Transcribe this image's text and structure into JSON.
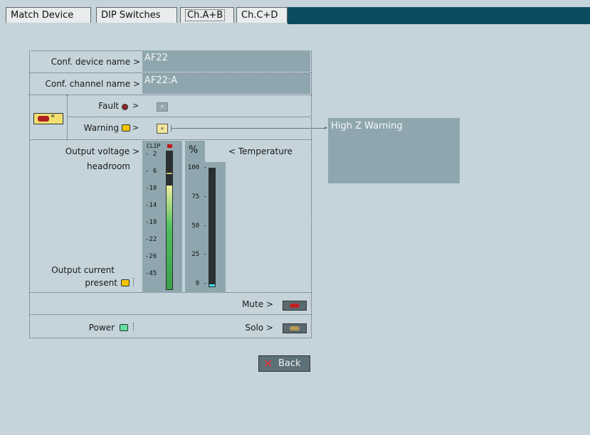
{
  "tabs": [
    {
      "label": "Match Device"
    },
    {
      "label": "DIP Switches"
    },
    {
      "label": "Ch.A+B",
      "active": true
    },
    {
      "label": "Ch.C+D"
    }
  ],
  "panel": {
    "device_name_label": "Conf. device name >",
    "device_name_value": "AF22",
    "channel_name_label": "Conf. channel name >",
    "channel_name_value": "AF22:A",
    "fault_label": "Fault",
    "warning_label": "Warning",
    "warning_message": "High Z Warning",
    "output_voltage_label_line1": "Output voltage >",
    "output_voltage_label_line2": "headroom",
    "percent_label": "%",
    "temperature_label": "< Temperature",
    "output_current_line1": "Output current",
    "output_current_line2": "present",
    "mute_label": "Mute >",
    "power_label": "Power",
    "solo_label": "Solo >",
    "arrow": ">",
    "clip_label": "CLIP",
    "voltage_scale": [
      "- 2",
      "- 6",
      "-10",
      "-14",
      "-18",
      "-22",
      "-26",
      "-45"
    ],
    "temp_scale": [
      "100 -",
      "75 -",
      "50 -",
      "25 -",
      "0 -"
    ],
    "voltage_headroom_level": 0.75,
    "temperature_level": 0.02
  },
  "back_label": "Back",
  "colors": {
    "background": "#c4d4da",
    "field": "#8fa6ae",
    "titlebar": "#0d4c60",
    "led_red": "#8b2b2b",
    "led_yellow": "#f3c400",
    "led_green": "#5fe0a0",
    "meter_green": "#4fc060"
  }
}
